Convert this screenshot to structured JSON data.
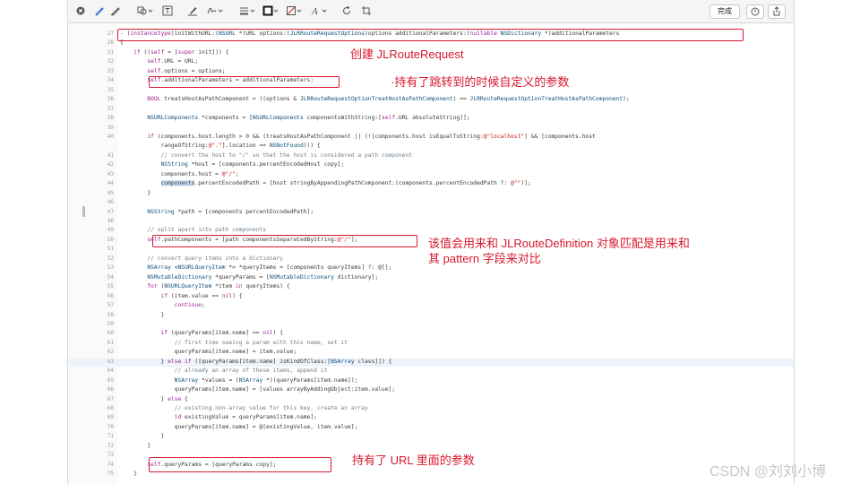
{
  "toolbar": {
    "done_label": "完成",
    "icons": [
      "close-circle-icon",
      "pen-icon",
      "highlighter-icon",
      "shapes-icon",
      "text-box-icon",
      "marker-icon",
      "signature-icon",
      "line-weight-icon",
      "border-color-icon",
      "fill-color-icon",
      "font-icon",
      "rotate-icon",
      "crop-icon",
      "markup-icon",
      "share-icon"
    ]
  },
  "code": {
    "lines": [
      {
        "n": "27",
        "t": "- (instancetype)initWithURL:(NSURL *)URL options:(JLRRouteRequestOptions)options additionalParameters:(nullable NSDictionary *)additionalParameters"
      },
      {
        "n": "28",
        "t": "{"
      },
      {
        "n": "31",
        "t": "    if ((self = [super init])) {"
      },
      {
        "n": "32",
        "t": "        self.URL = URL;"
      },
      {
        "n": "33",
        "t": "        self.options = options;"
      },
      {
        "n": "34",
        "t": "        self.additionalParameters = additionalParameters;"
      },
      {
        "n": "35",
        "t": ""
      },
      {
        "n": "36",
        "t": "        BOOL treatsHostAsPathComponent = ((options & JLRRouteRequestOptionTreatHostAsPathComponent) == JLRRouteRequestOptionTreatHostAsPathComponent);"
      },
      {
        "n": "37",
        "t": ""
      },
      {
        "n": "38",
        "t": "        NSURLComponents *components = [NSURLComponents componentsWithString:[self.URL absoluteString]];"
      },
      {
        "n": "39",
        "t": ""
      },
      {
        "n": "40",
        "t": "        if (components.host.length > 0 && (treatsHostAsPathComponent || (![components.host isEqualToString:@\"localhost\"] && [components.host"
      },
      {
        "n": "",
        "t": "            rangeOfString:@\".\"].location == NSNotFound))) {"
      },
      {
        "n": "41",
        "t": "            // convert the host to \"/\" so that the host is considered a path component"
      },
      {
        "n": "42",
        "t": "            NSString *host = [components.percentEncodedHost copy];"
      },
      {
        "n": "43",
        "t": "            components.host = @\"/\";"
      },
      {
        "n": "44",
        "t": "            components.percentEncodedPath = [host stringByAppendingPathComponent:(components.percentEncodedPath ?: @\"\")];"
      },
      {
        "n": "45",
        "t": "        }"
      },
      {
        "n": "46",
        "t": ""
      },
      {
        "n": "47",
        "t": "        NSString *path = [components percentEncodedPath];"
      },
      {
        "n": "48",
        "t": ""
      },
      {
        "n": "49",
        "t": "        // split apart into path components"
      },
      {
        "n": "50",
        "t": "        self.pathComponents = [path componentsSeparatedByString:@\"/\"];"
      },
      {
        "n": "51",
        "t": ""
      },
      {
        "n": "52",
        "t": "        // convert query items into a dictionary"
      },
      {
        "n": "53",
        "t": "        NSArray <NSURLQueryItem *> *queryItems = [components queryItems] ?: @[];"
      },
      {
        "n": "54",
        "t": "        NSMutableDictionary *queryParams = [NSMutableDictionary dictionary];"
      },
      {
        "n": "55",
        "t": "        for (NSURLQueryItem *item in queryItems) {"
      },
      {
        "n": "56",
        "t": "            if (item.value == nil) {"
      },
      {
        "n": "57",
        "t": "                continue;"
      },
      {
        "n": "58",
        "t": "            }"
      },
      {
        "n": "59",
        "t": ""
      },
      {
        "n": "60",
        "t": "            if (queryParams[item.name] == nil) {"
      },
      {
        "n": "61",
        "t": "                // first time seeing a param with this name, set it"
      },
      {
        "n": "62",
        "t": "                queryParams[item.name] = item.value;"
      },
      {
        "n": "63",
        "t": "            } else if ([queryParams[item.name] isKindOfClass:[NSArray class]]) {"
      },
      {
        "n": "64",
        "t": "                // already an array of these items, append it"
      },
      {
        "n": "65",
        "t": "                NSArray *values = (NSArray *)(queryParams[item.name]);"
      },
      {
        "n": "66",
        "t": "                queryParams[item.name] = [values arrayByAddingObject:item.value];"
      },
      {
        "n": "67",
        "t": "            } else {"
      },
      {
        "n": "68",
        "t": "                // existing non-array value for this key, create an array"
      },
      {
        "n": "69",
        "t": "                id existingValue = queryParams[item.name];"
      },
      {
        "n": "70",
        "t": "                queryParams[item.name] = @[existingValue, item.value];"
      },
      {
        "n": "71",
        "t": "            }"
      },
      {
        "n": "72",
        "t": "        }"
      },
      {
        "n": "73",
        "t": ""
      },
      {
        "n": "74",
        "t": "        self.queryParams = [queryParams copy];"
      },
      {
        "n": "75",
        "t": "    }"
      }
    ]
  },
  "annotations": {
    "a1": "创建 JLRouteRequest",
    "a2": "·持有了跳转到的时候自定义的参数",
    "a3_line1": "该值会用来和 JLRouteDefinition 对象匹配是用来和",
    "a3_line2": "其 pattern 字段来对比",
    "a4": "持有了 URL 里面的参数"
  },
  "watermark": "CSDN @刘刘小博",
  "colors": {
    "annotation": "#d8182d",
    "keyword": "#9b2393",
    "comment": "#707f8c",
    "string": "#c41a16",
    "highlight": "#cde3f7"
  }
}
